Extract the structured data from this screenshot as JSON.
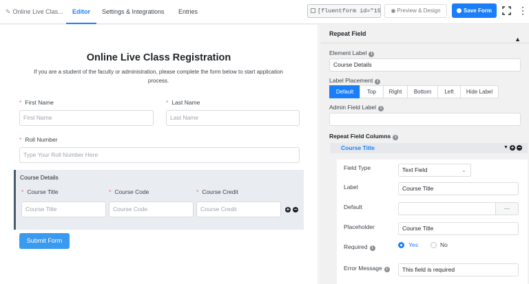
{
  "topbar": {
    "form_name": "Online Live Clas...",
    "tabs": [
      "Editor",
      "Settings & Integrations",
      "Entries"
    ],
    "shortcode": "[fluentform id=\"156\"]",
    "preview_label": "Preview & Design",
    "save_label": "Save Form"
  },
  "form": {
    "title": "Online Live Class Registration",
    "description": "If you are a student of the faculty or administration, please complete the form below to start application process.",
    "first_name": {
      "label": "First Name",
      "placeholder": "First Name"
    },
    "last_name": {
      "label": "Last Name",
      "placeholder": "Last Name"
    },
    "roll_number": {
      "label": "Roll Number",
      "placeholder": "Type Your Roll Number Here"
    },
    "repeat": {
      "label": "Course Details",
      "columns": [
        {
          "label": "Course Title",
          "placeholder": "Course Title"
        },
        {
          "label": "Course Code",
          "placeholder": "Course Code"
        },
        {
          "label": "Course Credit",
          "placeholder": "Course Credit"
        }
      ]
    },
    "submit_label": "Submit Form"
  },
  "panel": {
    "header": "Repeat Field",
    "element_label": {
      "label": "Element Label",
      "value": "Course Details"
    },
    "label_placement": {
      "label": "Label Placement",
      "options": [
        "Default",
        "Top",
        "Right",
        "Bottom",
        "Left",
        "Hide Label"
      ],
      "selected": "Default"
    },
    "admin_field_label": {
      "label": "Admin Field Label",
      "value": ""
    },
    "repeat_columns_label": "Repeat Field Columns",
    "column": {
      "title": "Course Title",
      "field_type": {
        "label": "Field Type",
        "value": "Text Field"
      },
      "label": {
        "label": "Label",
        "value": "Course Title"
      },
      "default": {
        "label": "Default",
        "value": "",
        "dots": "···"
      },
      "placeholder": {
        "label": "Placeholder",
        "value": "Course Title"
      },
      "required": {
        "label": "Required",
        "yes": "Yes",
        "no": "No",
        "selected": "Yes"
      },
      "error_message": {
        "label": "Error Message",
        "value": "This field is required"
      }
    }
  }
}
